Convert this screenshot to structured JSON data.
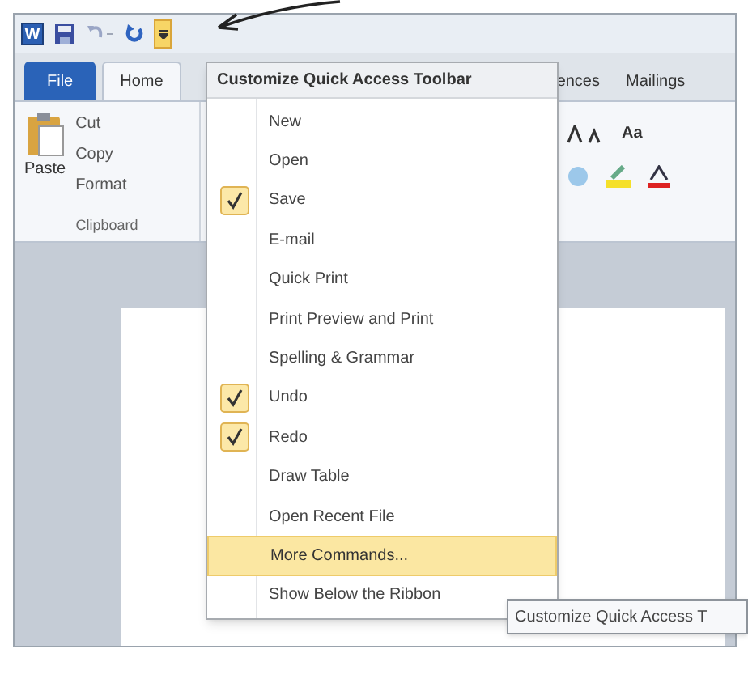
{
  "app_icon": "W",
  "tabs": [
    {
      "label": "File",
      "kind": "file",
      "selected": false
    },
    {
      "label": "Home",
      "kind": "tab",
      "selected": true
    },
    {
      "label": "ences",
      "kind": "tab",
      "selected": false
    },
    {
      "label": "Mailings",
      "kind": "tab",
      "selected": false
    }
  ],
  "clipboard": {
    "paste": "Paste",
    "items": [
      "Cut",
      "Copy",
      "Format"
    ],
    "group_label": "Clipboard"
  },
  "font_group": {
    "change_case": "Aa"
  },
  "menu": {
    "title": "Customize Quick Access Toolbar",
    "items": [
      {
        "label": "New",
        "checked": false,
        "selected": false
      },
      {
        "label": "Open",
        "checked": false,
        "selected": false
      },
      {
        "label": "Save",
        "checked": true,
        "selected": false
      },
      {
        "label": "E-mail",
        "checked": false,
        "selected": false
      },
      {
        "label": "Quick Print",
        "checked": false,
        "selected": false
      },
      {
        "label": "Print Preview and Print",
        "checked": false,
        "selected": false
      },
      {
        "label": "Spelling & Grammar",
        "checked": false,
        "selected": false
      },
      {
        "label": "Undo",
        "checked": true,
        "selected": false
      },
      {
        "label": "Redo",
        "checked": true,
        "selected": false
      },
      {
        "label": "Draw Table",
        "checked": false,
        "selected": false
      },
      {
        "label": "Open Recent File",
        "checked": false,
        "selected": false
      },
      {
        "label": "More Commands...",
        "checked": false,
        "selected": true
      },
      {
        "label": "Show Below the Ribbon",
        "checked": false,
        "selected": false
      }
    ]
  },
  "tooltip": "Customize Quick Access T"
}
